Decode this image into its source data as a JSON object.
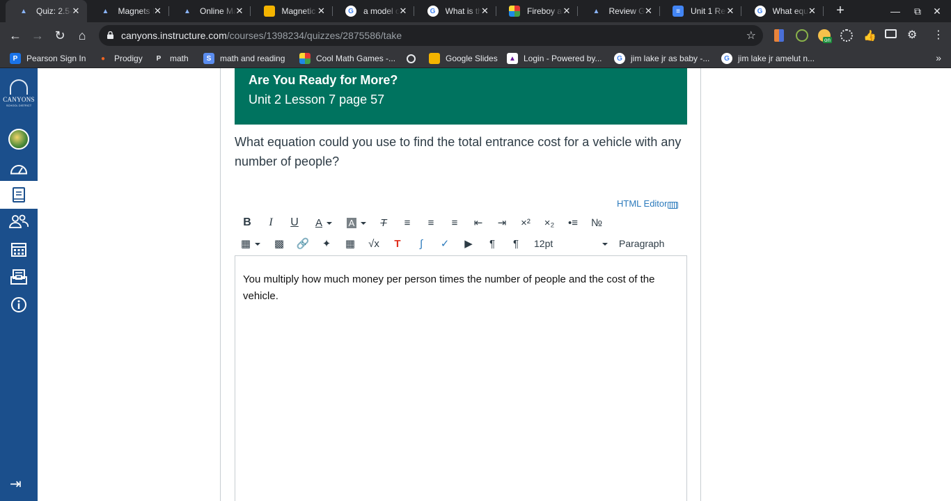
{
  "browser": {
    "tabs": [
      {
        "title": "Quiz: 2.5-",
        "favicon": "canvas-favicon",
        "active": true
      },
      {
        "title": "Magnets I",
        "favicon": "canvas-favicon",
        "active": false
      },
      {
        "title": "Online Ma",
        "favicon": "canvas-favicon",
        "active": false
      },
      {
        "title": "Magnetic",
        "favicon": "slides-favicon",
        "active": false
      },
      {
        "title": "a model o",
        "favicon": "google-favicon",
        "active": false
      },
      {
        "title": "What is th",
        "favicon": "google-favicon",
        "active": false
      },
      {
        "title": "Fireboy ar",
        "favicon": "game-favicon",
        "active": false
      },
      {
        "title": "Review Gu",
        "favicon": "canvas-favicon",
        "active": false
      },
      {
        "title": "Unit 1 Rev",
        "favicon": "docs-favicon",
        "active": false
      },
      {
        "title": "What equ",
        "favicon": "google-favicon",
        "active": false
      }
    ],
    "url_host": "canyons.instructure.com",
    "url_path": "/courses/1398234/quizzes/2875586/take",
    "bookmarks": [
      {
        "label": "Pearson Sign In",
        "icon": "pearson-icon"
      },
      {
        "label": "Prodigy",
        "icon": "prodigy-icon"
      },
      {
        "label": "math",
        "icon": "p-icon"
      },
      {
        "label": "math and reading",
        "icon": "s-icon"
      },
      {
        "label": "Cool Math Games -...",
        "icon": "coolmath-icon"
      },
      {
        "label": "",
        "icon": "globe-icon"
      },
      {
        "label": "Google Slides",
        "icon": "slides-icon"
      },
      {
        "label": "Login - Powered by...",
        "icon": "login-icon"
      },
      {
        "label": "jim lake jr as baby -...",
        "icon": "google-icon"
      },
      {
        "label": "jim lake jr amelut n...",
        "icon": "google-icon"
      }
    ],
    "colors": {
      "tabbar": "#202124",
      "toolbar": "#35363a"
    }
  },
  "canvas": {
    "logo": {
      "name": "CANYONS",
      "sub": "SCHOOL DISTRICT"
    },
    "nav": [
      "account",
      "dashboard",
      "courses",
      "groups",
      "calendar",
      "inbox",
      "help"
    ],
    "colors": {
      "nav": "#1b4f8c",
      "banner": "#00735f",
      "link": "#2b7abc"
    }
  },
  "quiz": {
    "banner_title": "Are You Ready for More?",
    "banner_subtitle": "Unit 2 Lesson 7 page 57",
    "question": "What equation could you use to find the total entrance cost for a vehicle with any number of people?",
    "html_editor_label": "HTML Editor",
    "font_size": "12pt",
    "block_format": "Paragraph",
    "answer": "You multiply how much money per person times the number of people and the cost of the vehicle."
  }
}
